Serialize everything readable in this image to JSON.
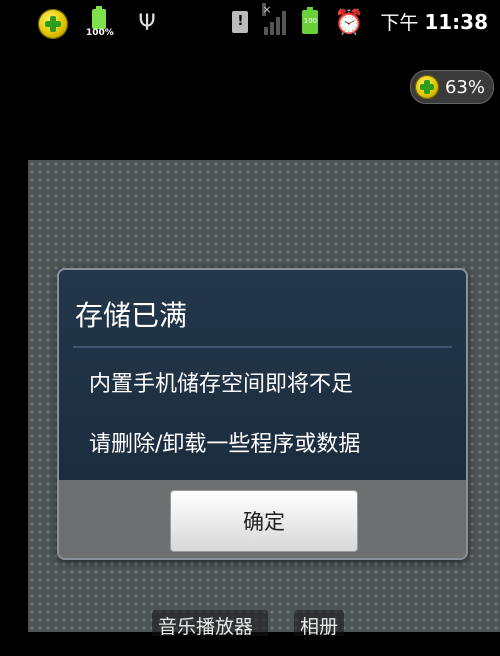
{
  "status_bar": {
    "battery_small_label": "100%",
    "battery_label": "100",
    "ampm": "下午",
    "time": "11:38",
    "icons": [
      "plus-icon",
      "battery-icon",
      "usb-icon",
      "sim-alert-icon",
      "signal-icon",
      "battery-icon",
      "alarm-icon"
    ]
  },
  "memory_badge": {
    "value": "63%"
  },
  "home_screen": {
    "labels": [
      "音乐播放器",
      "相册"
    ]
  },
  "dialog": {
    "title": "存储已满",
    "message_line1": "内置手机储存空间即将不足",
    "message_line2": "请删除/卸载一些程序或数据",
    "ok_label": "确定"
  },
  "colors": {
    "dialog_bg": "#24374b",
    "footer_bg": "#6d6f71",
    "wallpaper": "#4d5456"
  }
}
